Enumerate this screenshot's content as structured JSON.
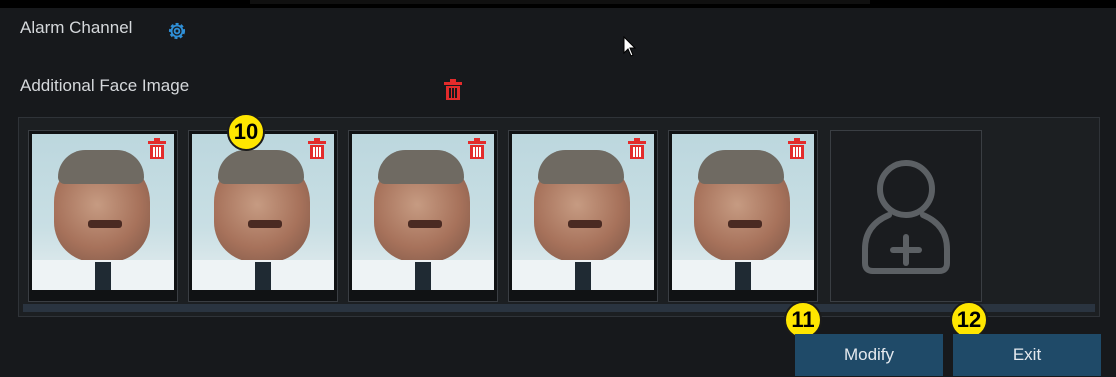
{
  "labels": {
    "alarm_channel": "Alarm Channel",
    "additional_face_image": "Additional Face Image"
  },
  "thumbnails": [
    {
      "icon": "face-photo"
    },
    {
      "icon": "face-photo"
    },
    {
      "icon": "face-photo"
    },
    {
      "icon": "face-photo"
    },
    {
      "icon": "face-photo"
    }
  ],
  "icons": {
    "settings": "gear-icon",
    "delete": "trash-icon",
    "add": "add-person-icon",
    "cursor": "mouse-cursor-icon"
  },
  "badges": [
    "10",
    "11",
    "12"
  ],
  "buttons": {
    "modify": "Modify",
    "exit": "Exit"
  },
  "colors": {
    "accent": "#2f8fd6",
    "delete": "#e32b2b",
    "button_bg": "#1f4a68",
    "badge": "#ffe600"
  }
}
